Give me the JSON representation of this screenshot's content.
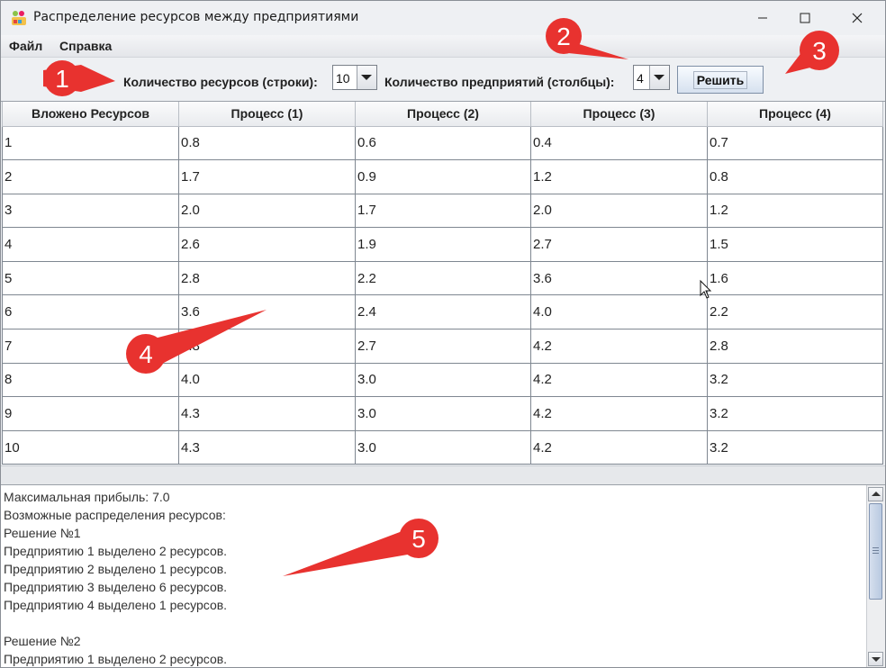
{
  "window": {
    "title": "Распределение ресурсов между предприятиями",
    "icon": "app-icon",
    "controls": [
      "minimize-icon",
      "maximize-icon",
      "close-icon"
    ]
  },
  "menu": [
    "Файл",
    "Справка"
  ],
  "toolbar": {
    "resources_label": "Количество ресурсов (строки):",
    "resources_value": "10",
    "enterprises_label": "Количество предприятий (столбцы):",
    "enterprises_value": "4",
    "solve_label": "Решить"
  },
  "table": {
    "headers": [
      "Вложено Ресурсов",
      "Процесс (1)",
      "Процесс (2)",
      "Процесс (3)",
      "Процесс (4)"
    ],
    "rows": [
      [
        "1",
        "0.8",
        "0.6",
        "0.4",
        "0.7"
      ],
      [
        "2",
        "1.7",
        "0.9",
        "1.2",
        "0.8"
      ],
      [
        "3",
        "2.0",
        "1.7",
        "2.0",
        "1.2"
      ],
      [
        "4",
        "2.6",
        "1.9",
        "2.7",
        "1.5"
      ],
      [
        "5",
        "2.8",
        "2.2",
        "3.6",
        "1.6"
      ],
      [
        "6",
        "3.6",
        "2.4",
        "4.0",
        "2.2"
      ],
      [
        "7",
        "3.8",
        "2.7",
        "4.2",
        "2.8"
      ],
      [
        "8",
        "4.0",
        "3.0",
        "4.2",
        "3.2"
      ],
      [
        "9",
        "4.3",
        "3.0",
        "4.2",
        "3.2"
      ],
      [
        "10",
        "4.3",
        "3.0",
        "4.2",
        "3.2"
      ]
    ]
  },
  "output": {
    "lines": [
      "Максимальная прибыль: 7.0",
      "Возможные распределения ресурсов:",
      "Решение №1",
      "Предприятию 1 выделено 2 ресурсов.",
      "Предприятию 2 выделено 1 ресурсов.",
      "Предприятию 3 выделено 6 ресурсов.",
      "Предприятию 4 выделено 1 ресурсов.",
      "",
      "Решение №2",
      "Предприятию 1 выделено 2 ресурсов."
    ]
  },
  "annotations": [
    "1",
    "2",
    "3",
    "4",
    "5"
  ],
  "colors": {
    "annotation_red": "#e8322f",
    "button_blue": "#d6e1ef"
  }
}
